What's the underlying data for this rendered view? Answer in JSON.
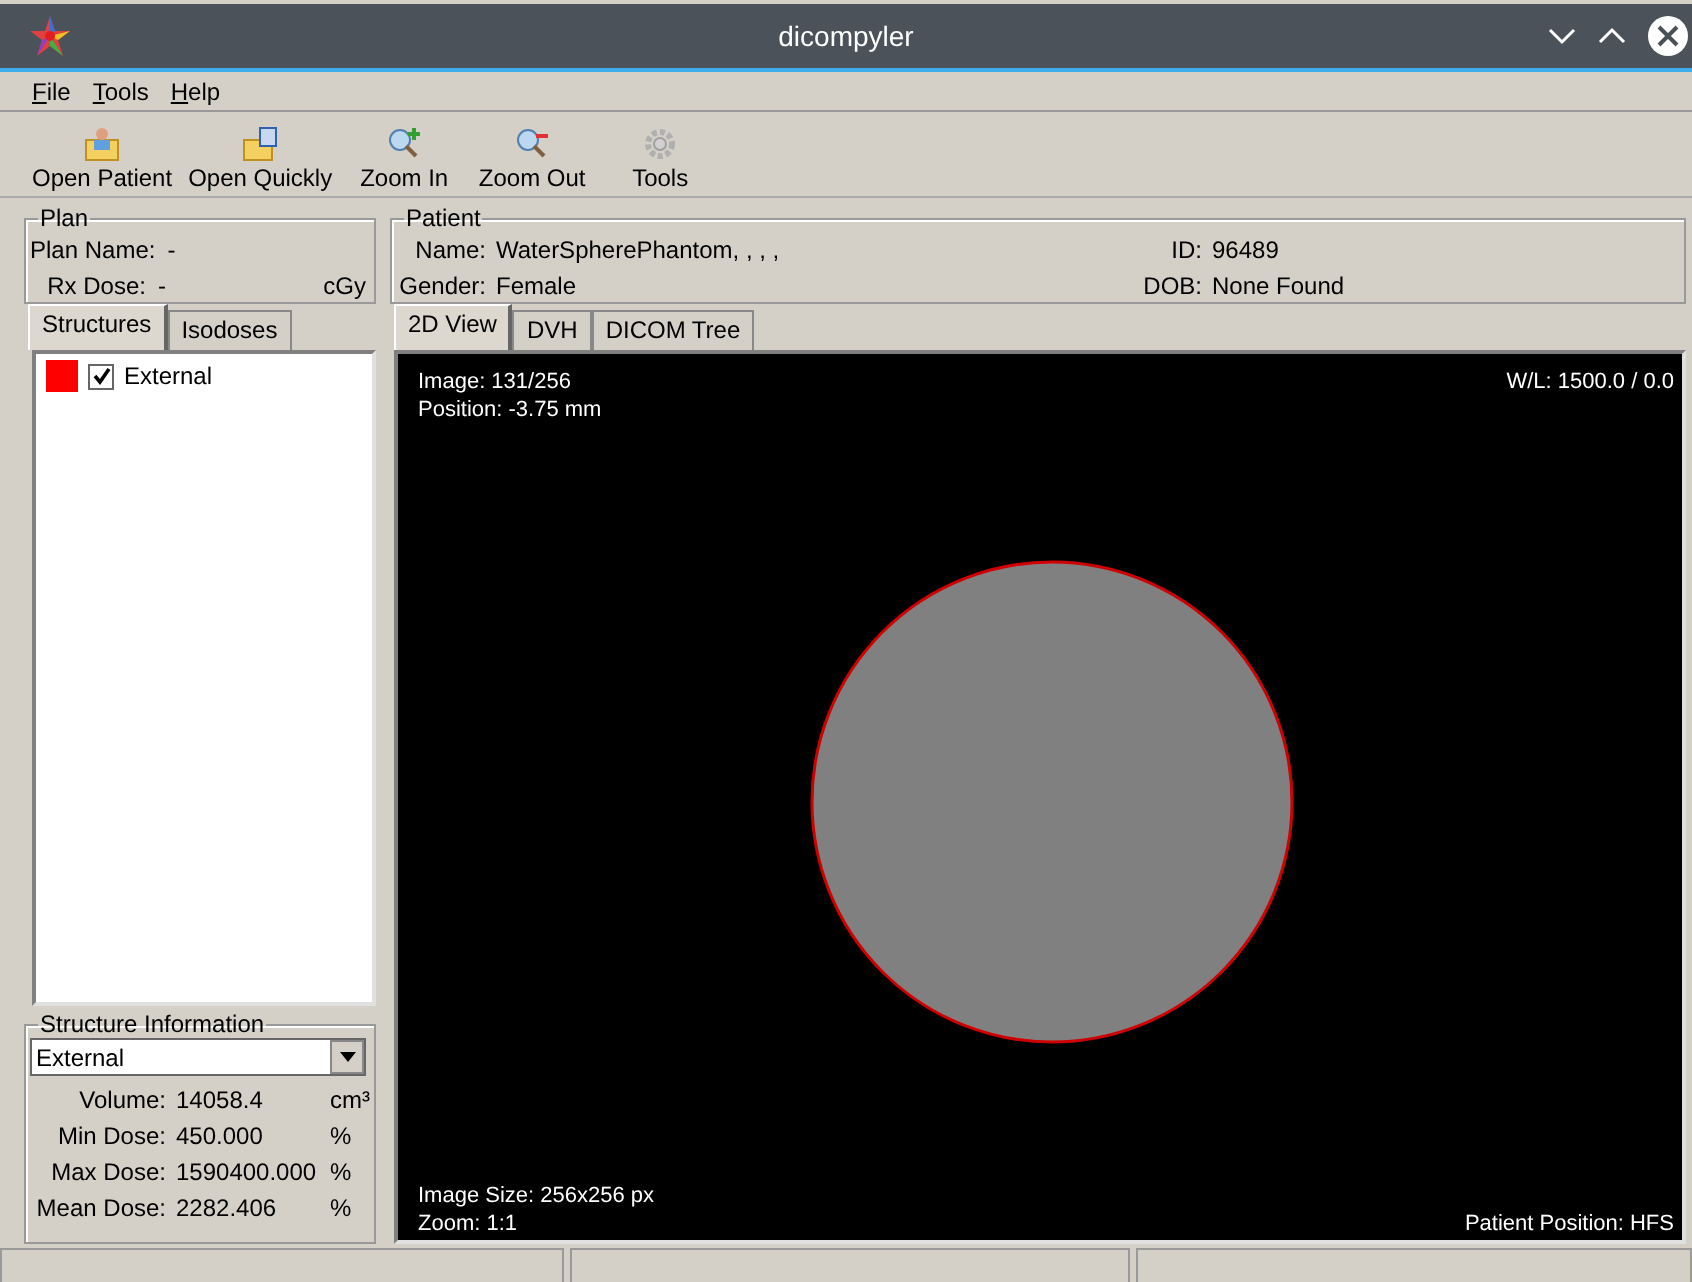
{
  "window": {
    "title": "dicompyler"
  },
  "menu": [
    "File",
    "Tools",
    "Help"
  ],
  "toolbar": [
    {
      "label": "Open Patient",
      "kind": "open-patient"
    },
    {
      "label": "Open Quickly",
      "kind": "open-quickly"
    },
    {
      "label": "Zoom In",
      "kind": "zoom-in"
    },
    {
      "label": "Zoom Out",
      "kind": "zoom-out"
    },
    {
      "label": "Tools",
      "kind": "tools"
    }
  ],
  "plan": {
    "title": "Plan",
    "name_label": "Plan Name:",
    "name": "-",
    "rx_label": "Rx Dose:",
    "rx": "-",
    "rx_unit": "cGy"
  },
  "patient": {
    "title": "Patient",
    "name_label": "Name:",
    "name": "WaterSpherePhantom, , , ,",
    "id_label": "ID:",
    "id": "96489",
    "gender_label": "Gender:",
    "gender": "Female",
    "dob_label": "DOB:",
    "dob": "None Found"
  },
  "left_tabs": [
    {
      "label": "Structures",
      "selected": true
    },
    {
      "label": "Isodoses",
      "selected": false
    }
  ],
  "structures": [
    {
      "name": "External",
      "checked": true,
      "color": "#ff0000"
    }
  ],
  "structure_info": {
    "title": "Structure Information",
    "selection": "External",
    "rows": [
      {
        "label": "Volume:",
        "value": "14058.4",
        "unit": "cm³"
      },
      {
        "label": "Min Dose:",
        "value": "450.000",
        "unit": "%"
      },
      {
        "label": "Max Dose:",
        "value": "1590400.000",
        "unit": "%"
      },
      {
        "label": "Mean Dose:",
        "value": "2282.406",
        "unit": "%"
      }
    ]
  },
  "view_tabs": [
    {
      "label": "2D View",
      "selected": true
    },
    {
      "label": "DVH",
      "selected": false
    },
    {
      "label": "DICOM Tree",
      "selected": false
    }
  ],
  "viewer": {
    "image": "Image: 131/256",
    "position": "Position: -3.75 mm",
    "wl": "W/L: 1500.0 / 0.0",
    "image_size": "Image Size: 256x256 px",
    "zoom": "Zoom: 1:1",
    "patient_position": "Patient Position: HFS"
  }
}
